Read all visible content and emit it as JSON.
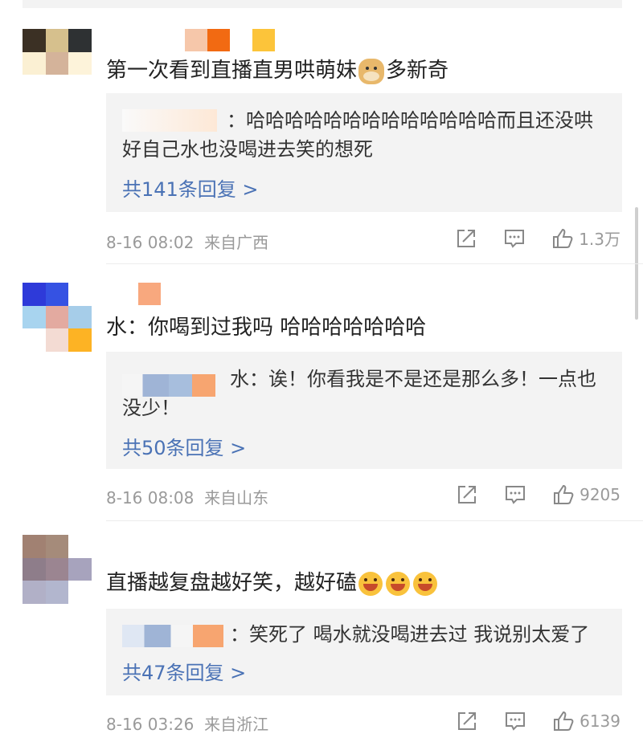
{
  "comments": [
    {
      "text": "第一次看到直播直男哄萌妹",
      "text_tail": "多新奇",
      "reply_text": "：哈哈哈哈哈哈哈哈哈哈哈哈哈而且还没哄好自己水也没喝进去笑的想死",
      "more_replies": "共141条回复 >",
      "time": "8-16 08:02",
      "location": "来自广西",
      "likes": "1.3万"
    },
    {
      "text": "水：你喝到过我吗 哈哈哈哈哈哈哈",
      "reply_text": "水：诶！你看我是不是还是那么多！一点也没少！",
      "more_replies": "共50条回复 >",
      "time": "8-16 08:08",
      "location": "来自山东",
      "likes": "9205"
    },
    {
      "text": "直播越复盘越好笑，越好磕",
      "reply_text": "：笑死了 喝水就没喝进去过 我说别太爱了",
      "more_replies": "共47条回复 >",
      "time": "8-16 03:26",
      "location": "来自浙江",
      "likes": "6139"
    }
  ],
  "icons": {
    "share": "share-icon",
    "comment": "comment-icon",
    "like": "thumbs-up-icon",
    "emoji_doge": "doge-emoji-icon",
    "emoji_laugh": "laughing-crying-emoji-icon"
  },
  "colors": {
    "link": "#4a72b5",
    "meta": "#9a9a9a",
    "reply_bg": "#f3f3f3"
  }
}
